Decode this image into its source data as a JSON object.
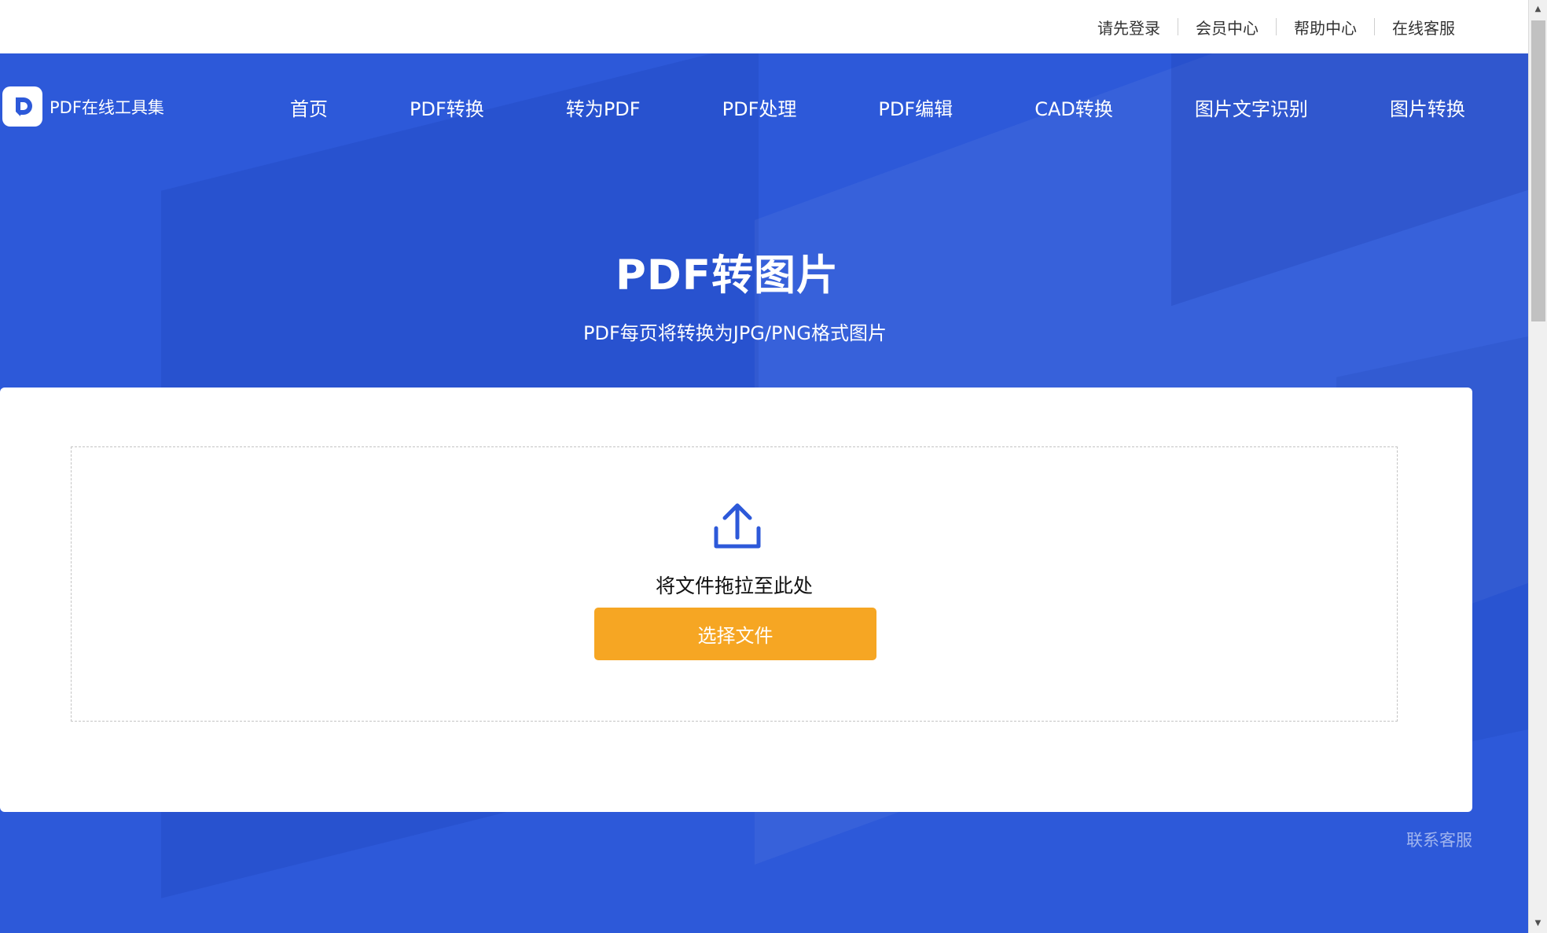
{
  "topbar": {
    "links": [
      "请先登录",
      "会员中心",
      "帮助中心",
      "在线客服"
    ]
  },
  "brand": {
    "name": "PDF在线工具集",
    "accent": "#2d59d9"
  },
  "nav": {
    "items": [
      "首页",
      "PDF转换",
      "转为PDF",
      "PDF处理",
      "PDF编辑",
      "CAD转换",
      "图片文字识别",
      "图片转换"
    ]
  },
  "hero": {
    "title": "PDF转图片",
    "subtitle": "PDF每页将转换为JPG/PNG格式图片"
  },
  "upload": {
    "icon": "upload-icon",
    "drop_text": "将文件拖拉至此处",
    "button_label": "选择文件",
    "button_color": "#f6a623"
  },
  "footer": {
    "contact_label": "联系客服"
  }
}
